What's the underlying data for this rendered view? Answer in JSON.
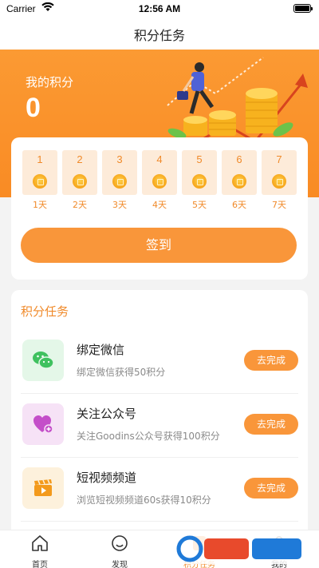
{
  "status_bar": {
    "carrier": "Carrier",
    "time": "12:56 AM"
  },
  "nav": {
    "title": "积分任务"
  },
  "points": {
    "label": "我的积分",
    "value": "0"
  },
  "signin": {
    "days": [
      {
        "num": "1",
        "label": "1天"
      },
      {
        "num": "2",
        "label": "2天"
      },
      {
        "num": "3",
        "label": "3天"
      },
      {
        "num": "4",
        "label": "4天"
      },
      {
        "num": "5",
        "label": "5天"
      },
      {
        "num": "6",
        "label": "6天"
      },
      {
        "num": "7",
        "label": "7天"
      }
    ],
    "button_label": "签到"
  },
  "tasks": {
    "section_title": "积分任务",
    "items": [
      {
        "title": "绑定微信",
        "desc": "绑定微信获得50积分",
        "button": "去完成",
        "icon": "wechat-icon",
        "color": "#3fc15f",
        "bg": "#e4f7e8"
      },
      {
        "title": "关注公众号",
        "desc": "关注Goodins公众号获得100积分",
        "button": "去完成",
        "icon": "heart-plus-icon",
        "color": "#c44fc9",
        "bg": "#f6e2f6"
      },
      {
        "title": "短视频频道",
        "desc": "浏览短视频频道60s获得10积分",
        "button": "去完成",
        "icon": "clapperboard-icon",
        "color": "#f39a1c",
        "bg": "#fdf1dc"
      }
    ]
  },
  "tabbar": {
    "items": [
      {
        "label": "首页",
        "icon": "home-icon"
      },
      {
        "label": "发现",
        "icon": "discover-icon"
      },
      {
        "label": "积分任务",
        "icon": "task-icon"
      },
      {
        "label": "我的",
        "icon": "profile-icon"
      }
    ]
  },
  "accent": "#f9963a"
}
